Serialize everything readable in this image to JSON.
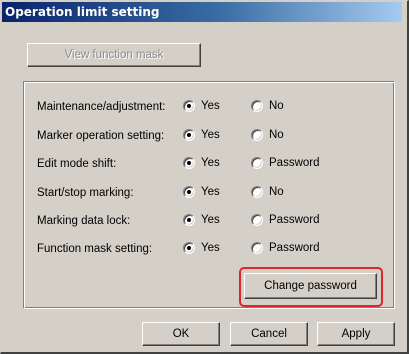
{
  "window": {
    "title": "Operation limit setting"
  },
  "view_mask_button": "View function mask",
  "settings": [
    {
      "label": "Maintenance/adjustment:",
      "option1": "Yes",
      "option2": "No",
      "selected": "option1"
    },
    {
      "label": "Marker operation setting:",
      "option1": "Yes",
      "option2": "No",
      "selected": "option1"
    },
    {
      "label": "Edit mode shift:",
      "option1": "Yes",
      "option2": "Password",
      "selected": "option1"
    },
    {
      "label": "Start/stop marking:",
      "option1": "Yes",
      "option2": "No",
      "selected": "option1"
    },
    {
      "label": "Marking data lock:",
      "option1": "Yes",
      "option2": "Password",
      "selected": "option1"
    },
    {
      "label": "Function mask setting:",
      "option1": "Yes",
      "option2": "Password",
      "selected": "option1"
    }
  ],
  "change_password_button": "Change password",
  "footer": {
    "ok": "OK",
    "cancel": "Cancel",
    "apply": "Apply"
  },
  "colors": {
    "highlight": "#e0242b",
    "titlebar": "#0a246a"
  }
}
